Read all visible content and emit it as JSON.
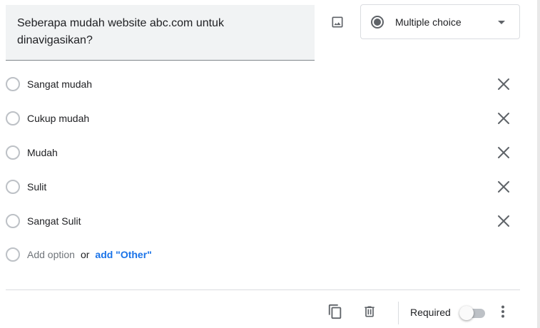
{
  "question": {
    "title": "Seberapa mudah website abc.com untuk dinavigasikan?"
  },
  "question_type": {
    "selected": "Multiple choice"
  },
  "options": [
    {
      "label": "Sangat mudah"
    },
    {
      "label": "Cukup mudah"
    },
    {
      "label": "Mudah"
    },
    {
      "label": "Sulit"
    },
    {
      "label": "Sangat Sulit"
    }
  ],
  "add_row": {
    "add_option": "Add option",
    "or": "or",
    "add_other": "add \"Other\""
  },
  "footer": {
    "required_label": "Required",
    "required_on": false
  },
  "icons": {
    "image": "image-icon",
    "radio": "radio-button-icon",
    "dropdown": "dropdown-arrow-icon",
    "remove": "close-icon",
    "duplicate": "copy-icon",
    "delete": "trash-icon",
    "more": "more-vert-icon"
  },
  "colors": {
    "question_bg": "#f1f3f4",
    "link": "#1a73e8",
    "icon": "#5f6368"
  }
}
